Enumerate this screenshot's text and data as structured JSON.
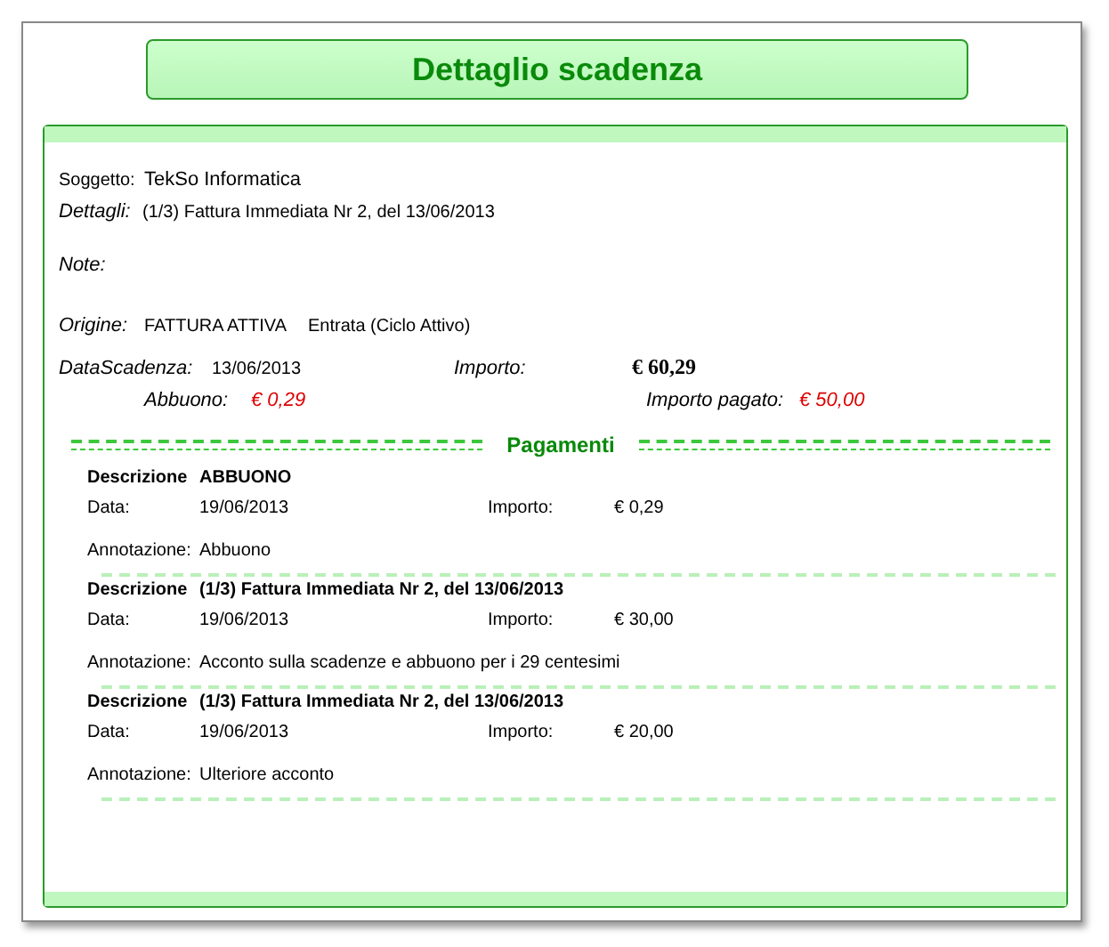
{
  "title": "Dettaglio scadenza",
  "soggetto": {
    "label": "Soggetto:",
    "value": "TekSo Informatica"
  },
  "dettagli": {
    "label": "Dettagli:",
    "value": "(1/3) Fattura Immediata Nr 2, del 13/06/2013"
  },
  "note": {
    "label": "Note:"
  },
  "origine": {
    "label": "Origine:",
    "type": "FATTURA ATTIVA",
    "category": "Entrata (Ciclo Attivo)"
  },
  "data_scadenza": {
    "label": "DataScadenza:",
    "value": "13/06/2013"
  },
  "importo": {
    "label": "Importo:",
    "value": "€ 60,29"
  },
  "abbuono": {
    "label": "Abbuono:",
    "value": "€ 0,29"
  },
  "importo_pagato": {
    "label": "Importo pagato:",
    "value": "€ 50,00"
  },
  "pagamenti": {
    "heading": "Pagamenti",
    "items": [
      {
        "descrizione_label": "Descrizione",
        "descrizione": "ABBUONO",
        "data_label": "Data:",
        "data": "19/06/2013",
        "importo_label": "Importo:",
        "importo": "€ 0,29",
        "annotazione_label": "Annotazione:",
        "annotazione": "Abbuono"
      },
      {
        "descrizione_label": "Descrizione",
        "descrizione": "(1/3) Fattura Immediata Nr 2, del 13/06/2013",
        "data_label": "Data:",
        "data": "19/06/2013",
        "importo_label": "Importo:",
        "importo": "€ 30,00",
        "annotazione_label": "Annotazione:",
        "annotazione": "Acconto sulla scadenze e abbuono per i 29 centesimi"
      },
      {
        "descrizione_label": "Descrizione",
        "descrizione": "(1/3) Fattura Immediata Nr 2, del 13/06/2013",
        "data_label": "Data:",
        "data": "19/06/2013",
        "importo_label": "Importo:",
        "importo": "€ 20,00",
        "annotazione_label": "Annotazione:",
        "annotazione": "Ulteriore acconto"
      }
    ]
  }
}
